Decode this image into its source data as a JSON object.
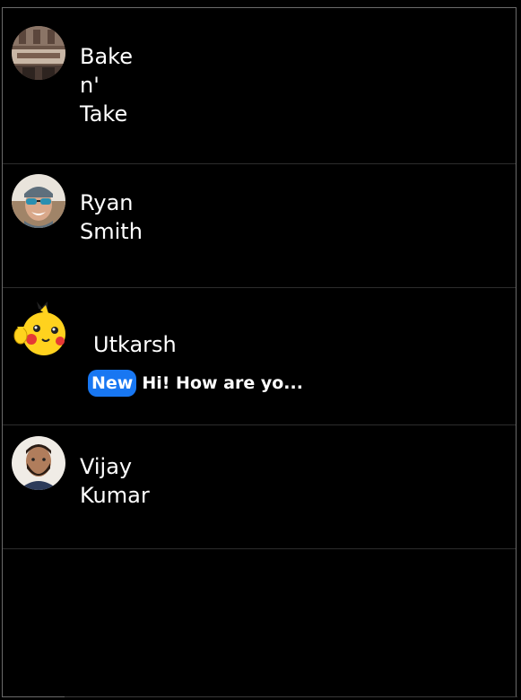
{
  "chats": [
    {
      "name": "Bake n' Take",
      "avatar_icon": "storefront-photo-avatar",
      "preview": null
    },
    {
      "name": "Ryan Smith",
      "avatar_icon": "man-sunglasses-photo-avatar",
      "preview": null
    },
    {
      "name": "Utkarsh",
      "avatar_icon": "pikachu-avatar",
      "preview": {
        "badge": "New",
        "message": "Hi! How are yo..."
      }
    },
    {
      "name": "Vijay Kumar",
      "avatar_icon": "man-beard-photo-avatar",
      "preview": null
    }
  ],
  "colors": {
    "background": "#000000",
    "badge": "#1877f2",
    "text": "#ffffff",
    "divider": "#2c2c2c"
  }
}
